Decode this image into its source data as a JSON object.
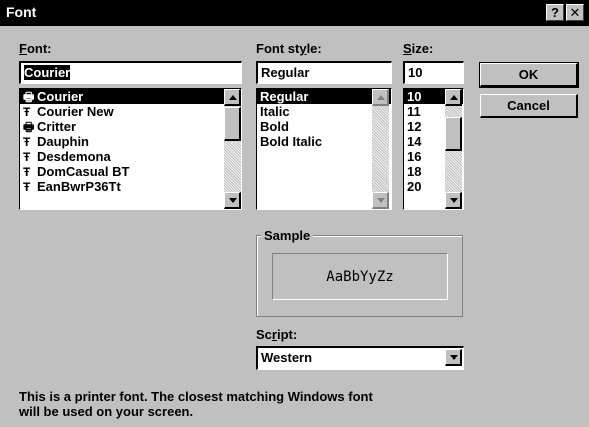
{
  "window": {
    "title": "Font",
    "help_button": "?",
    "close_button": "✕"
  },
  "font": {
    "label_prefix": "",
    "label_accel": "F",
    "label_rest": "ont:",
    "value": "Courier",
    "items": [
      {
        "name": "Courier",
        "icon": "printer-font-icon",
        "glyph": "🖶"
      },
      {
        "name": "Courier New",
        "icon": "truetype-icon",
        "glyph": "Ŧ"
      },
      {
        "name": "Critter",
        "icon": "printer-font-icon",
        "glyph": "🖶"
      },
      {
        "name": "Dauphin",
        "icon": "truetype-icon",
        "glyph": "Ŧ"
      },
      {
        "name": "Desdemona",
        "icon": "truetype-icon",
        "glyph": "Ŧ"
      },
      {
        "name": "DomCasual BT",
        "icon": "truetype-icon",
        "glyph": "Ŧ"
      },
      {
        "name": "EanBwrP36Tt",
        "icon": "truetype-icon",
        "glyph": "Ŧ"
      }
    ],
    "selected_index": 0
  },
  "style": {
    "label_prefix": "Font st",
    "label_accel": "y",
    "label_rest": "le:",
    "value": "Regular",
    "items": [
      "Regular",
      "Italic",
      "Bold",
      "Bold Italic"
    ],
    "selected_index": 0
  },
  "size": {
    "label_prefix": "",
    "label_accel": "S",
    "label_rest": "ize:",
    "value": "10",
    "items": [
      "10",
      "11",
      "12",
      "14",
      "16",
      "18",
      "20"
    ],
    "selected_index": 0
  },
  "buttons": {
    "ok": "OK",
    "cancel": "Cancel"
  },
  "sample": {
    "caption": "Sample",
    "text": "AaBbYyZz"
  },
  "script": {
    "label_prefix": "Sc",
    "label_accel": "r",
    "label_rest": "ipt:",
    "value": "Western"
  },
  "info": {
    "line1": "This is a printer font. The closest matching Windows font",
    "line2": "will be used on your screen."
  },
  "colors": {
    "face": "#c0c0c0",
    "title_bar": "#000000",
    "selection": "#000000"
  }
}
